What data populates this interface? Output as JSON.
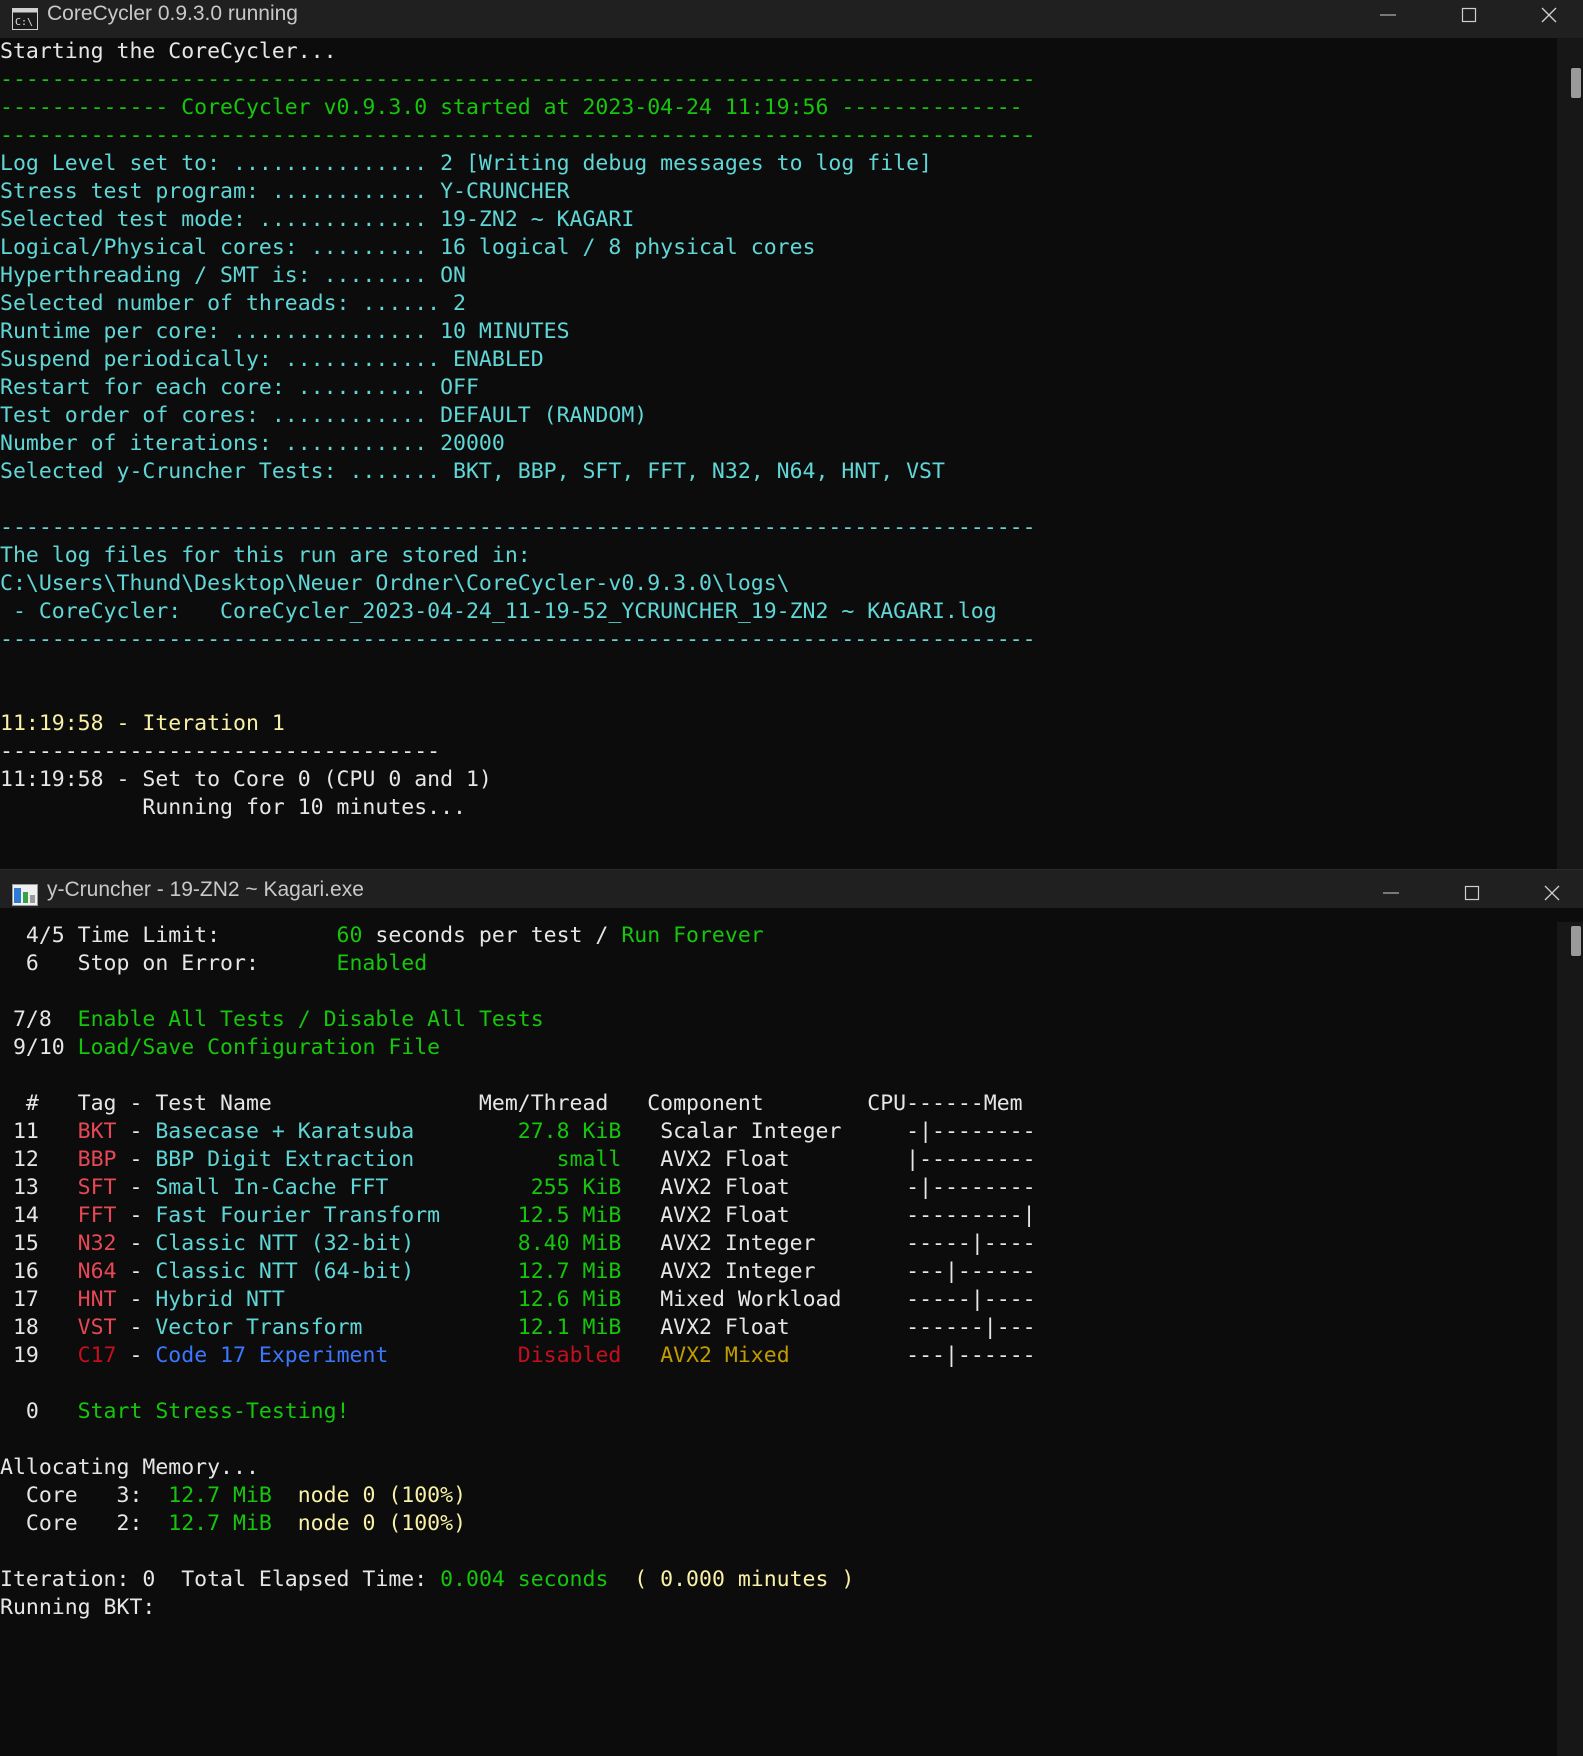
{
  "win1": {
    "title": "CoreCycler 0.9.3.0 running",
    "lines": [
      {
        "type": "plain",
        "cls": "wh",
        "text": "Starting the CoreCycler..."
      },
      {
        "type": "plain",
        "cls": "gr",
        "text": "--------------------------------------------------------------------------------"
      },
      {
        "type": "plain",
        "cls": "gr",
        "text": "------------- CoreCycler v0.9.3.0 started at 2023-04-24 11:19:56 --------------"
      },
      {
        "type": "plain",
        "cls": "gr",
        "text": "--------------------------------------------------------------------------------"
      },
      {
        "type": "plain",
        "cls": "cy",
        "text": "Log Level set to: ............... 2 [Writing debug messages to log file]"
      },
      {
        "type": "plain",
        "cls": "cy",
        "text": "Stress test program: ............ Y-CRUNCHER"
      },
      {
        "type": "plain",
        "cls": "cy",
        "text": "Selected test mode: ............. 19-ZN2 ~ KAGARI"
      },
      {
        "type": "plain",
        "cls": "cy",
        "text": "Logical/Physical cores: ......... 16 logical / 8 physical cores"
      },
      {
        "type": "plain",
        "cls": "cy",
        "text": "Hyperthreading / SMT is: ........ ON"
      },
      {
        "type": "plain",
        "cls": "cy",
        "text": "Selected number of threads: ...... 2"
      },
      {
        "type": "plain",
        "cls": "cy",
        "text": "Runtime per core: ............... 10 MINUTES"
      },
      {
        "type": "plain",
        "cls": "cy",
        "text": "Suspend periodically: ............ ENABLED"
      },
      {
        "type": "plain",
        "cls": "cy",
        "text": "Restart for each core: .......... OFF"
      },
      {
        "type": "plain",
        "cls": "cy",
        "text": "Test order of cores: ............ DEFAULT (RANDOM)"
      },
      {
        "type": "plain",
        "cls": "cy",
        "text": "Number of iterations: ........... 20000"
      },
      {
        "type": "plain",
        "cls": "cy",
        "text": "Selected y-Cruncher Tests: ....... BKT, BBP, SFT, FFT, N32, N64, HNT, VST"
      },
      {
        "type": "plain",
        "cls": "cy",
        "text": ""
      },
      {
        "type": "plain",
        "cls": "cy",
        "text": "--------------------------------------------------------------------------------"
      },
      {
        "type": "plain",
        "cls": "cy",
        "text": "The log files for this run are stored in:"
      },
      {
        "type": "plain",
        "cls": "cy",
        "text": "C:\\Users\\Thund\\Desktop\\Neuer Ordner\\CoreCycler-v0.9.3.0\\logs\\"
      },
      {
        "type": "plain",
        "cls": "cy",
        "text": " - CoreCycler:   CoreCycler_2023-04-24_11-19-52_YCRUNCHER_19-ZN2 ~ KAGARI.log"
      },
      {
        "type": "plain",
        "cls": "cy",
        "text": "--------------------------------------------------------------------------------"
      },
      {
        "type": "plain",
        "cls": "cy",
        "text": ""
      },
      {
        "type": "plain",
        "cls": "cy",
        "text": ""
      },
      {
        "type": "plain",
        "cls": "yl",
        "text": "11:19:58 - Iteration 1"
      },
      {
        "type": "plain",
        "cls": "wh",
        "text": "----------------------------------"
      },
      {
        "type": "plain",
        "cls": "wh",
        "text": "11:19:58 - Set to Core 0 (CPU 0 and 1)"
      },
      {
        "type": "plain",
        "cls": "wh",
        "text": "           Running for 10 minutes..."
      }
    ]
  },
  "win2": {
    "title": "y-Cruncher - 19-ZN2 ~ Kagari.exe",
    "lines": [
      {
        "type": "segs",
        "segs": [
          {
            "c": "wh",
            "t": "  4/5 Time Limit:         "
          },
          {
            "c": "gr",
            "t": "60"
          },
          {
            "c": "wh",
            "t": " seconds per test / "
          },
          {
            "c": "gr",
            "t": "Run Forever"
          }
        ]
      },
      {
        "type": "segs",
        "segs": [
          {
            "c": "wh",
            "t": "  6   Stop on Error:      "
          },
          {
            "c": "gr",
            "t": "Enabled"
          }
        ]
      },
      {
        "type": "segs",
        "segs": [
          {
            "c": "wh",
            "t": ""
          }
        ]
      },
      {
        "type": "segs",
        "segs": [
          {
            "c": "wh",
            "t": " 7/8  "
          },
          {
            "c": "gr",
            "t": "Enable All Tests / Disable All Tests"
          }
        ]
      },
      {
        "type": "segs",
        "segs": [
          {
            "c": "wh",
            "t": " 9/10 "
          },
          {
            "c": "gr",
            "t": "Load/Save Configuration File"
          }
        ]
      },
      {
        "type": "segs",
        "segs": [
          {
            "c": "wh",
            "t": ""
          }
        ]
      },
      {
        "type": "segs",
        "segs": [
          {
            "c": "wh",
            "t": "  #   Tag - Test Name                Mem/Thread   Component        CPU------Mem"
          }
        ]
      },
      {
        "type": "segs",
        "segs": [
          {
            "c": "wh",
            "t": " 11   "
          },
          {
            "c": "rd",
            "t": "BKT"
          },
          {
            "c": "wh",
            "t": " - "
          },
          {
            "c": "cy",
            "t": "Basecase + Karatsuba      "
          },
          {
            "c": "gr",
            "t": "  27.8 KiB"
          },
          {
            "c": "wh",
            "t": "   Scalar Integer     -|--------"
          }
        ]
      },
      {
        "type": "segs",
        "segs": [
          {
            "c": "wh",
            "t": " 12   "
          },
          {
            "c": "rd",
            "t": "BBP"
          },
          {
            "c": "wh",
            "t": " - "
          },
          {
            "c": "cy",
            "t": "BBP Digit Extraction      "
          },
          {
            "c": "gr",
            "t": "     small"
          },
          {
            "c": "wh",
            "t": "   AVX2 Float         |---------"
          }
        ]
      },
      {
        "type": "segs",
        "segs": [
          {
            "c": "wh",
            "t": " 13   "
          },
          {
            "c": "rd",
            "t": "SFT"
          },
          {
            "c": "wh",
            "t": " - "
          },
          {
            "c": "cy",
            "t": "Small In-Cache FFT        "
          },
          {
            "c": "gr",
            "t": "   255 KiB"
          },
          {
            "c": "wh",
            "t": "   AVX2 Float         -|--------"
          }
        ]
      },
      {
        "type": "segs",
        "segs": [
          {
            "c": "wh",
            "t": " 14   "
          },
          {
            "c": "rd",
            "t": "FFT"
          },
          {
            "c": "wh",
            "t": " - "
          },
          {
            "c": "cy",
            "t": "Fast Fourier Transform    "
          },
          {
            "c": "gr",
            "t": "  12.5 MiB"
          },
          {
            "c": "wh",
            "t": "   AVX2 Float         ---------|"
          }
        ]
      },
      {
        "type": "segs",
        "segs": [
          {
            "c": "wh",
            "t": " 15   "
          },
          {
            "c": "rd",
            "t": "N32"
          },
          {
            "c": "wh",
            "t": " - "
          },
          {
            "c": "cy",
            "t": "Classic NTT (32-bit)      "
          },
          {
            "c": "gr",
            "t": "  8.40 MiB"
          },
          {
            "c": "wh",
            "t": "   AVX2 Integer       -----|----"
          }
        ]
      },
      {
        "type": "segs",
        "segs": [
          {
            "c": "wh",
            "t": " 16   "
          },
          {
            "c": "rd",
            "t": "N64"
          },
          {
            "c": "wh",
            "t": " - "
          },
          {
            "c": "cy",
            "t": "Classic NTT (64-bit)      "
          },
          {
            "c": "gr",
            "t": "  12.7 MiB"
          },
          {
            "c": "wh",
            "t": "   AVX2 Integer       ---|------"
          }
        ]
      },
      {
        "type": "segs",
        "segs": [
          {
            "c": "wh",
            "t": " 17   "
          },
          {
            "c": "rd",
            "t": "HNT"
          },
          {
            "c": "wh",
            "t": " - "
          },
          {
            "c": "cy",
            "t": "Hybrid NTT                "
          },
          {
            "c": "gr",
            "t": "  12.6 MiB"
          },
          {
            "c": "wh",
            "t": "   Mixed Workload     -----|----"
          }
        ]
      },
      {
        "type": "segs",
        "segs": [
          {
            "c": "wh",
            "t": " 18   "
          },
          {
            "c": "rd",
            "t": "VST"
          },
          {
            "c": "wh",
            "t": " - "
          },
          {
            "c": "cy",
            "t": "Vector Transform          "
          },
          {
            "c": "gr",
            "t": "  12.1 MiB"
          },
          {
            "c": "wh",
            "t": "   AVX2 Float         ------|---"
          }
        ]
      },
      {
        "type": "segs",
        "segs": [
          {
            "c": "wh",
            "t": " 19   "
          },
          {
            "c": "dr",
            "t": "C17"
          },
          {
            "c": "wh",
            "t": " - "
          },
          {
            "c": "bl",
            "t": "Code 17 Experiment        "
          },
          {
            "c": "dr",
            "t": "  Disabled"
          },
          {
            "c": "wh",
            "t": "   "
          },
          {
            "c": "or",
            "t": "AVX2 Mixed"
          },
          {
            "c": "wh",
            "t": "         ---|------"
          }
        ]
      },
      {
        "type": "segs",
        "segs": [
          {
            "c": "wh",
            "t": ""
          }
        ]
      },
      {
        "type": "segs",
        "segs": [
          {
            "c": "wh",
            "t": "  0   "
          },
          {
            "c": "gr",
            "t": "Start Stress-Testing!"
          }
        ]
      },
      {
        "type": "segs",
        "segs": [
          {
            "c": "wh",
            "t": ""
          }
        ]
      },
      {
        "type": "segs",
        "segs": [
          {
            "c": "wh",
            "t": "Allocating Memory..."
          }
        ]
      },
      {
        "type": "segs",
        "segs": [
          {
            "c": "wh",
            "t": "  Core   3:  "
          },
          {
            "c": "gr",
            "t": "12.7 MiB"
          },
          {
            "c": "wh",
            "t": "  "
          },
          {
            "c": "yl",
            "t": "node 0 (100%)"
          }
        ]
      },
      {
        "type": "segs",
        "segs": [
          {
            "c": "wh",
            "t": "  Core   2:  "
          },
          {
            "c": "gr",
            "t": "12.7 MiB"
          },
          {
            "c": "wh",
            "t": "  "
          },
          {
            "c": "yl",
            "t": "node 0 (100%)"
          }
        ]
      },
      {
        "type": "segs",
        "segs": [
          {
            "c": "wh",
            "t": ""
          }
        ]
      },
      {
        "type": "segs",
        "segs": [
          {
            "c": "wh",
            "t": "Iteration: 0  Total Elapsed Time: "
          },
          {
            "c": "gr",
            "t": "0.004 seconds"
          },
          {
            "c": "wh",
            "t": "  "
          },
          {
            "c": "yl",
            "t": "( 0.000 minutes )"
          }
        ]
      },
      {
        "type": "segs",
        "segs": [
          {
            "c": "wh",
            "t": "Running BKT:"
          }
        ]
      }
    ]
  }
}
